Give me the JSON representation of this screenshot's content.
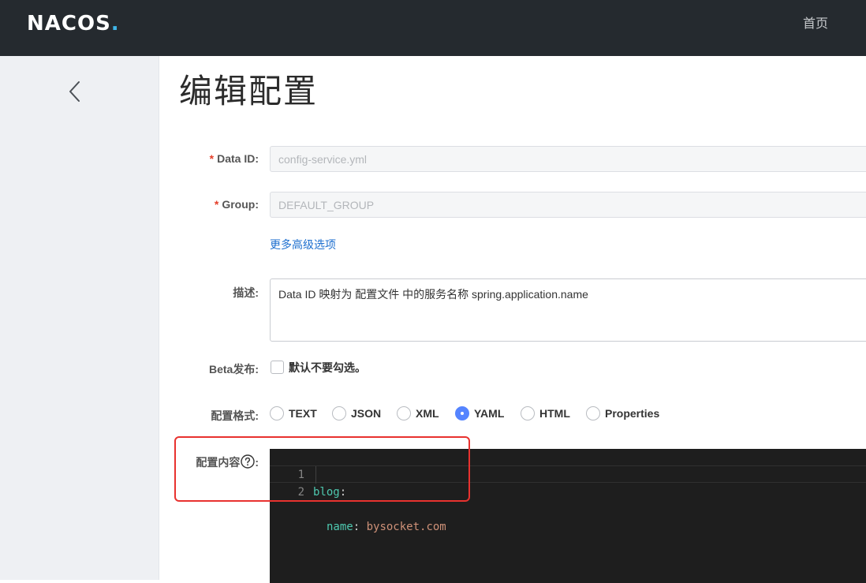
{
  "header": {
    "logo_text": "NACOS",
    "logo_dot": ".",
    "nav_home": "首页"
  },
  "sidebar": {
    "back_icon": "chevron-left-icon"
  },
  "page": {
    "title": "编辑配置"
  },
  "form": {
    "required_mark": "*",
    "data_id": {
      "label": "Data ID:",
      "value": "config-service.yml"
    },
    "group": {
      "label": "Group:",
      "value": "DEFAULT_GROUP"
    },
    "advanced_link": "更多高级选项",
    "description": {
      "label": "描述:",
      "value": "Data ID 映射为 配置文件 中的服务名称 spring.application.name"
    },
    "beta": {
      "label": "Beta发布:",
      "checkbox_label": "默认不要勾选。",
      "checked": false
    },
    "format": {
      "label": "配置格式:",
      "options": [
        "TEXT",
        "JSON",
        "XML",
        "YAML",
        "HTML",
        "Properties"
      ],
      "selected": "YAML"
    },
    "content": {
      "label": "配置内容",
      "help_icon": "question-circle-icon",
      "colon": ":",
      "lines": [
        {
          "num": "1",
          "key": "blog",
          "sep": ":",
          "value": ""
        },
        {
          "num": "2",
          "key": "name",
          "sep": ":",
          "value": "bysocket.com"
        }
      ]
    }
  },
  "annotation": {
    "color": "#e8322f"
  },
  "colors": {
    "topbar": "#252a2f",
    "sidebar": "#eef0f3",
    "accent": "#5584ff",
    "link": "#1d6fcf",
    "editor_bg": "#1e1e1e"
  }
}
